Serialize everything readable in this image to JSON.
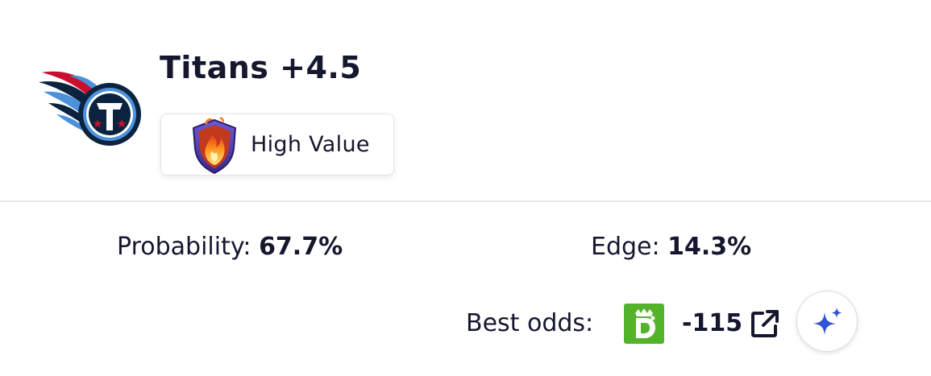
{
  "bet": {
    "title": "Titans +4.5",
    "team_logo_icon": "titans-logo-icon",
    "badge": {
      "label": "High Value",
      "icon": "flame-shield-icon"
    }
  },
  "stats": {
    "probability_label": "Probability:",
    "probability_value": "67.7%",
    "edge_label": "Edge:",
    "edge_value": "14.3%"
  },
  "odds": {
    "label": "Best odds:",
    "sportsbook_icon": "draftkings-logo-icon",
    "value": "-115",
    "link_icon": "external-link-icon",
    "ai_icon": "sparkle-icon"
  },
  "colors": {
    "text": "#15172e",
    "divider": "#e5e6ea",
    "sportsbook_green": "#53b32b",
    "ai_blue": "#2f55d4",
    "titans_navy": "#0c2340",
    "titans_blue": "#4b92db",
    "titans_red": "#c8102e"
  }
}
